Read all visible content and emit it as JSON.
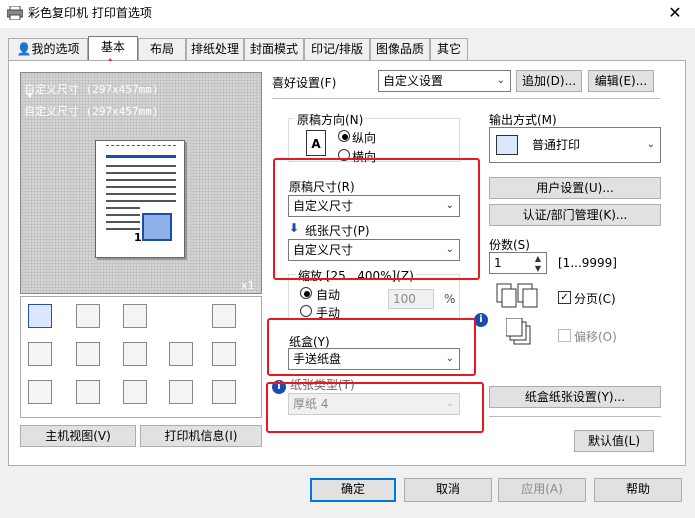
{
  "window": {
    "title": "彩色复印机 打印首选项",
    "close_glyph": "✕"
  },
  "tabs": [
    {
      "label": "我的选项"
    },
    {
      "label": "基本"
    },
    {
      "label": "布局"
    },
    {
      "label": "排纸处理"
    },
    {
      "label": "封面模式"
    },
    {
      "label": "印记/排版"
    },
    {
      "label": "图像品质"
    },
    {
      "label": "其它"
    }
  ],
  "preview": {
    "line1": "自定义尺寸 (297x457mm)",
    "line2": "自定义尺寸 (297x457mm)",
    "count": "x1",
    "page_number": "1"
  },
  "left_buttons": {
    "host_view": "主机视图(V)",
    "printer_info": "打印机信息(I)"
  },
  "favorites": {
    "label": "喜好设置(F)",
    "value": "自定义设置",
    "add_label": "追加(D)...",
    "edit_label": "编辑(E)..."
  },
  "orientation": {
    "label": "原稿方向(N)",
    "portrait": "纵向",
    "landscape": "横向"
  },
  "original_size": {
    "label": "原稿尺寸(R)",
    "value": "自定义尺寸"
  },
  "paper_size": {
    "label": "纸张尺寸(P)",
    "value": "自定义尺寸"
  },
  "zoom": {
    "label": "缩放 [25...400%](Z)",
    "auto": "自动",
    "manual": "手动",
    "value": "100",
    "unit": "%"
  },
  "tray": {
    "label": "纸盒(Y)",
    "value": "手送纸盘"
  },
  "paper_type": {
    "label": "纸张类型(T)",
    "value": "厚纸 4"
  },
  "output": {
    "label": "输出方式(M)",
    "value": "普通打印"
  },
  "right_buttons": {
    "user_settings": "用户设置(U)...",
    "auth": "认证/部门管理(K)...",
    "tray_settings": "纸盒纸张设置(Y)...",
    "defaults": "默认值(L)"
  },
  "copies": {
    "label": "份数(S)",
    "value": "1",
    "range": "[1...9999]"
  },
  "collate": {
    "label": "分页(C)"
  },
  "offset": {
    "label": "偏移(O)"
  },
  "footer": {
    "ok": "确定",
    "cancel": "取消",
    "apply": "应用(A)",
    "help": "帮助"
  },
  "colors": {
    "highlight": "#e8191e",
    "accent": "#0078d7",
    "arrow": "#1b4db0"
  }
}
